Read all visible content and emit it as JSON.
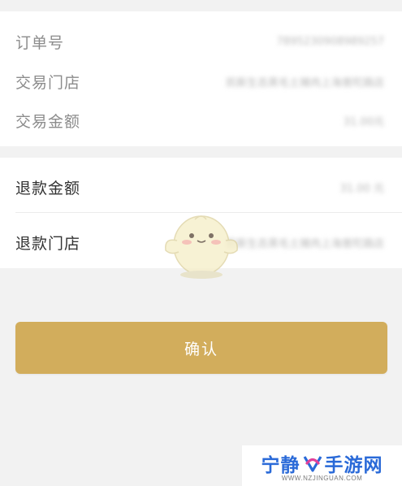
{
  "order_info": {
    "rows": [
      {
        "label": "订单号",
        "value": "7895230908989257"
      },
      {
        "label": "交易门店",
        "value": "凯斯生态黑毛土猪肉上海普陀路店"
      },
      {
        "label": "交易金额",
        "value": "31.00元"
      }
    ]
  },
  "refund_info": {
    "rows": [
      {
        "label": "退款金额",
        "value": "31.00 元"
      },
      {
        "label": "退款门店",
        "value": "凯斯生态黑毛土猪肉上海普陀路店"
      }
    ]
  },
  "confirm_button": {
    "label": "确认"
  },
  "watermark": {
    "title_left": "宁静",
    "title_right": "手游网",
    "subtitle": "WWW.NZJINGUAN.COM",
    "colors": {
      "blue": "#2a6ad8",
      "pink": "#e0409a"
    }
  },
  "colors": {
    "accent": "#d2ad5c",
    "background": "#f2f2f2"
  }
}
